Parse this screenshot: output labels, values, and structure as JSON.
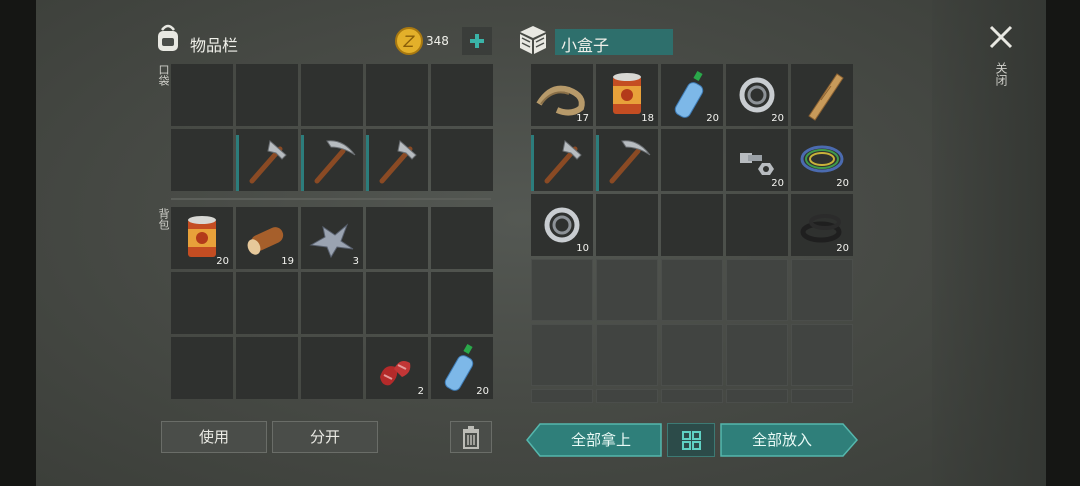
{
  "inventory": {
    "title": "物品栏",
    "coins": "348",
    "pocket_label": "口袋",
    "backpack_label": "背包",
    "pocket_slots": [
      {
        "item": "",
        "count": ""
      },
      {
        "item": "",
        "count": ""
      },
      {
        "item": "",
        "count": ""
      },
      {
        "item": "",
        "count": ""
      },
      {
        "item": "",
        "count": ""
      },
      {
        "item": "",
        "count": ""
      },
      {
        "item": "hatchet-icon",
        "count": ""
      },
      {
        "item": "pickaxe-icon",
        "count": ""
      },
      {
        "item": "hatchet-icon",
        "count": ""
      },
      {
        "item": "",
        "count": ""
      }
    ],
    "backpack_slots": [
      {
        "item": "canned-food-icon",
        "count": "20"
      },
      {
        "item": "log-icon",
        "count": "19"
      },
      {
        "item": "metal-scrap-icon",
        "count": "3"
      },
      {
        "item": "",
        "count": ""
      },
      {
        "item": "",
        "count": ""
      },
      {
        "item": "",
        "count": ""
      },
      {
        "item": "",
        "count": ""
      },
      {
        "item": "",
        "count": ""
      },
      {
        "item": "",
        "count": ""
      },
      {
        "item": "",
        "count": ""
      },
      {
        "item": "",
        "count": ""
      },
      {
        "item": "",
        "count": ""
      },
      {
        "item": "",
        "count": ""
      },
      {
        "item": "raw-meat-icon",
        "count": "2"
      },
      {
        "item": "water-bottle-icon",
        "count": "20"
      }
    ],
    "use_label": "使用",
    "split_label": "分开"
  },
  "box": {
    "name": "小盒子",
    "slots": [
      {
        "item": "rope-icon",
        "count": "17"
      },
      {
        "item": "canned-food-icon",
        "count": "18"
      },
      {
        "item": "water-bottle-icon",
        "count": "20"
      },
      {
        "item": "bearing-icon",
        "count": "20"
      },
      {
        "item": "wooden-plank-icon",
        "count": ""
      },
      {
        "item": "hatchet-icon",
        "count": ""
      },
      {
        "item": "pickaxe-icon",
        "count": ""
      },
      {
        "item": "",
        "count": ""
      },
      {
        "item": "bolt-nut-icon",
        "count": "20"
      },
      {
        "item": "wire-coil-icon",
        "count": "20"
      },
      {
        "item": "bearing-icon",
        "count": "10"
      },
      {
        "item": "",
        "count": ""
      },
      {
        "item": "",
        "count": ""
      },
      {
        "item": "",
        "count": ""
      },
      {
        "item": "rubber-ring-icon",
        "count": "20"
      }
    ],
    "take_all_label": "全部拿上",
    "put_all_label": "全部放入"
  },
  "close_label": "关闭",
  "colors": {
    "accent": "#2f7f7a",
    "slot": "#2f312f",
    "slot_empty": "#414441",
    "tool_bar": "#2c7d7c"
  }
}
